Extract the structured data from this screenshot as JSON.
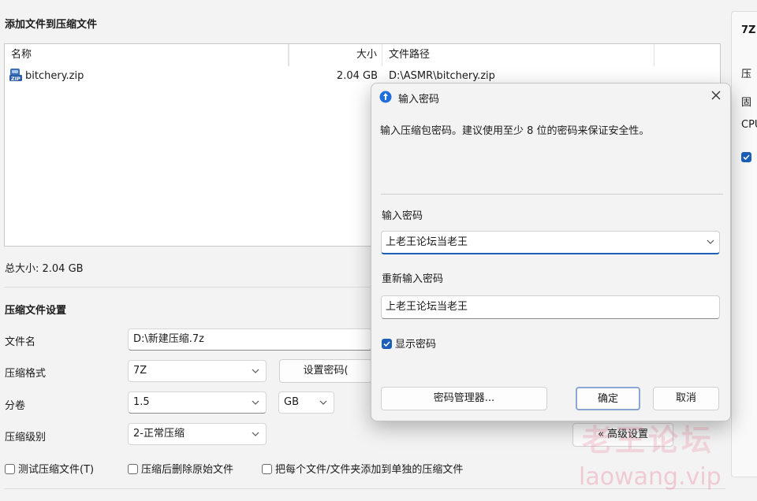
{
  "window": {
    "section_add_files": "添加文件到压缩文件",
    "total_size_label": "总大小: 2.04 GB"
  },
  "file_list": {
    "columns": [
      "名称",
      "大小",
      "文件路径"
    ],
    "rows": [
      {
        "name": "bitchery.zip",
        "size": "2.04 GB",
        "path": "D:\\ASMR\\bitchery.zip",
        "icon": "zip-file-icon"
      }
    ]
  },
  "settings": {
    "section_title": "压缩文件设置",
    "file_name_label": "文件名",
    "file_name_value": "D:\\新建压缩.7z",
    "format_label": "压缩格式",
    "format_value": "7Z",
    "set_password_button": "设置密码(",
    "split_label": "分卷",
    "split_value": "1.5",
    "split_unit": "GB",
    "level_label": "压缩级别",
    "level_value": "2-正常压缩",
    "advanced_button": "« 高级设置",
    "checkboxes": [
      {
        "label": "测试压缩文件(T)",
        "checked": false
      },
      {
        "label": "压缩后删除原始文件",
        "checked": false
      },
      {
        "label": "把每个文件/文件夹添加到单独的压缩文件",
        "checked": false
      }
    ]
  },
  "right_panel": {
    "title": "7Z",
    "items": [
      "压",
      "固",
      "CPU"
    ]
  },
  "dialog": {
    "title": "输入密码",
    "description": "输入压缩包密码。建议使用至少 8 位的密码来保证安全性。",
    "password_label": "输入密码",
    "password_value": "上老王论坛当老王",
    "confirm_label": "重新输入密码",
    "confirm_value": "上老王论坛当老王",
    "show_password_label": "显示密码",
    "show_password_checked": true,
    "manager_button": "密码管理器...",
    "ok_button": "确定",
    "cancel_button": "取消",
    "close_icon": "close-icon"
  },
  "watermark": {
    "cn": "老王论坛",
    "en": "laowang.vip"
  },
  "colors": {
    "accent": "#1c5fb8",
    "window_bg": "#f3f3f3"
  }
}
